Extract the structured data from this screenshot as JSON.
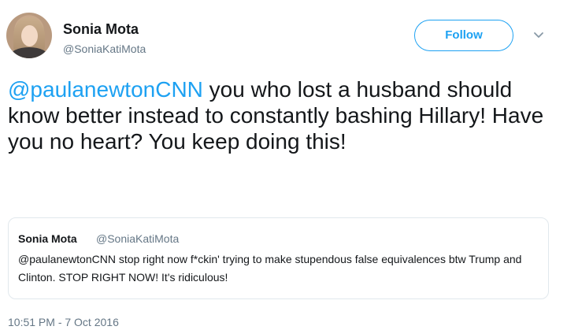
{
  "tweet": {
    "author": {
      "name": "Sonia Mota",
      "handle": "@SoniaKatiMota"
    },
    "follow_label": "Follow",
    "text": {
      "mention": "@paulanewtonCNN",
      "body": " you who lost a husband should know better instead to constantly bashing Hillary! Have you no heart? You keep doing this!"
    },
    "quoted": {
      "name": "Sonia Mota",
      "handle": "@SoniaKatiMota",
      "text": "@paulanewtonCNN stop right now f*ckin' trying to make stupendous false equivalences btw Trump and Clinton. STOP RIGHT NOW! It's ridiculous!"
    },
    "timestamp": "10:51 PM - 7 Oct 2016"
  },
  "colors": {
    "accent": "#1da1f2",
    "text": "#14171a",
    "muted": "#657786",
    "border": "#e1e8ed"
  },
  "icons": {
    "menu": "chevron-down-icon"
  }
}
